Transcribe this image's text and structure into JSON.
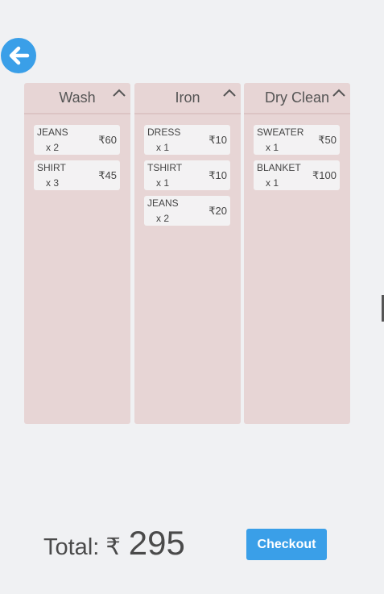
{
  "currency_symbol": "₹",
  "colors": {
    "accent": "#3a9fe8",
    "column_bg": "#e7d5d5",
    "card_bg": "#f3f2f3",
    "page_bg": "#f0f1f3"
  },
  "back_button": {
    "icon": "arrow-left-icon"
  },
  "columns": [
    {
      "title": "Wash",
      "items": [
        {
          "name": "JEANS",
          "qty": "x 2",
          "price": "₹60"
        },
        {
          "name": "SHIRT",
          "qty": "x 3",
          "price": "₹45"
        }
      ]
    },
    {
      "title": "Iron",
      "items": [
        {
          "name": "DRESS",
          "qty": "x 1",
          "price": "₹10"
        },
        {
          "name": "TSHIRT",
          "qty": "x 1",
          "price": "₹10"
        },
        {
          "name": "JEANS",
          "qty": "x 2",
          "price": "₹20"
        }
      ]
    },
    {
      "title": "Dry Clean",
      "items": [
        {
          "name": "SWEATER",
          "qty": "x 1",
          "price": "₹50"
        },
        {
          "name": "BLANKET",
          "qty": "x 1",
          "price": "₹100"
        }
      ]
    }
  ],
  "footer": {
    "total_label": "Total:",
    "total_currency": "₹",
    "total_amount": "295",
    "checkout_label": "Checkout"
  }
}
